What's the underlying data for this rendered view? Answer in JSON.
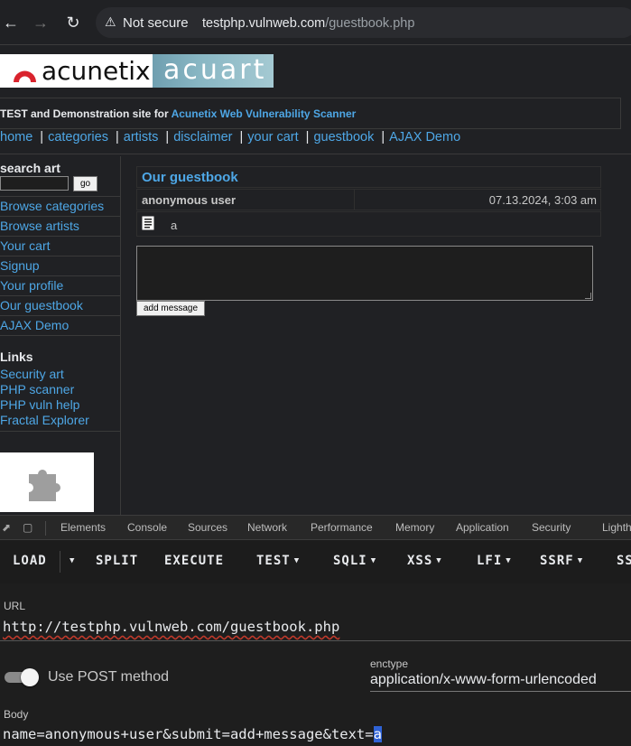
{
  "browser": {
    "security_label": "Not secure",
    "url_host": "testphp.vulnweb.com",
    "url_path": "/guestbook.php"
  },
  "site": {
    "logo_left": "acunetix",
    "logo_right": "acuart",
    "tagline_prefix": "TEST and Demonstration site for ",
    "tagline_highlight": "Acunetix Web Vulnerability Scanner",
    "nav": [
      "home",
      "categories",
      "artists",
      "disclaimer",
      "your cart",
      "guestbook",
      "AJAX Demo"
    ],
    "sidebar": {
      "search_title": "search art",
      "go_label": "go",
      "links": [
        "Browse categories",
        "Browse artists",
        "Your cart",
        "Signup",
        "Your profile",
        "Our guestbook",
        "AJAX Demo"
      ],
      "links_title": "Links",
      "external_links": [
        "Security art",
        "PHP scanner",
        "PHP vuln help",
        "Fractal Explorer"
      ]
    },
    "guestbook": {
      "title": "Our guestbook",
      "entry_user": "anonymous user",
      "entry_date": "07.13.2024, 3:03 am",
      "entry_text": "a",
      "add_button": "add message"
    }
  },
  "devtools": {
    "tabs": [
      "Elements",
      "Console",
      "Sources",
      "Network",
      "Performance",
      "Memory",
      "Application",
      "Security",
      "Lighthouse"
    ]
  },
  "hackbar": {
    "buttons": {
      "load": "LOAD",
      "split": "SPLIT",
      "execute": "EXECUTE",
      "test": "TEST",
      "sqli": "SQLI",
      "xss": "XSS",
      "lfi": "LFI",
      "ssrf": "SSRF",
      "more": "SS"
    },
    "url_label": "URL",
    "url_value": "http://testphp.vulnweb.com/guestbook.php",
    "post_label": "Use POST method",
    "post_enabled": true,
    "enctype_label": "enctype",
    "enctype_value": "application/x-www-form-urlencoded",
    "body_label": "Body",
    "body_value_prefix": "name=anonymous+user&submit=add+message&text=",
    "body_value_selected": "a"
  }
}
